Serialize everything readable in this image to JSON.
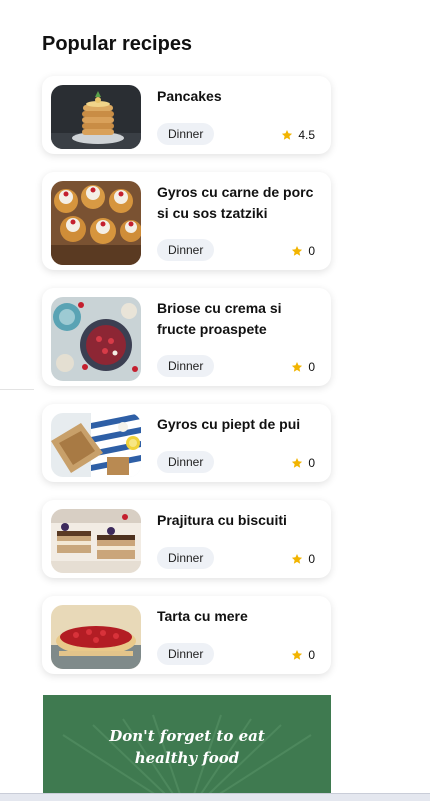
{
  "section": {
    "title": "Popular recipes"
  },
  "recipes": [
    {
      "name": "Pancakes",
      "tag": "Dinner",
      "rating": "4.5"
    },
    {
      "name": "Gyros cu carne de porc si cu sos tzatziki",
      "tag": "Dinner",
      "rating": "0"
    },
    {
      "name": "Briose cu crema si fructe proaspete",
      "tag": "Dinner",
      "rating": "0"
    },
    {
      "name": "Gyros cu piept de pui",
      "tag": "Dinner",
      "rating": "0"
    },
    {
      "name": "Prajitura cu biscuiti",
      "tag": "Dinner",
      "rating": "0"
    },
    {
      "name": "Tarta cu mere",
      "tag": "Dinner",
      "rating": "0"
    }
  ],
  "banner": {
    "line1": "Don't forget to eat",
    "line2": "healthy food"
  },
  "colors": {
    "star": "#f2b400",
    "tag_bg": "#eef1f6",
    "banner": "#3f7a50"
  },
  "icons": {
    "rating": "star-icon"
  }
}
